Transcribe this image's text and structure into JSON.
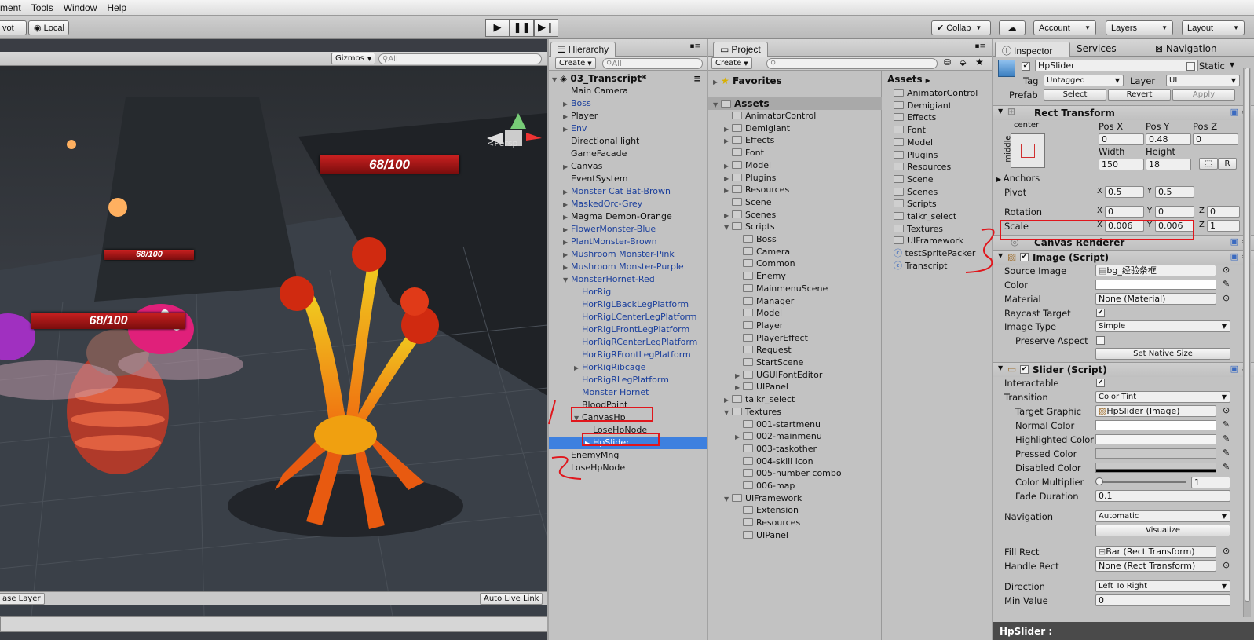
{
  "menubar": {
    "items": [
      "ment",
      "Tools",
      "Window",
      "Help"
    ]
  },
  "toolbar": {
    "pivot": "vot",
    "local": "Local",
    "collab": "Collab",
    "account": "Account",
    "layers": "Layers",
    "layout": "Layout"
  },
  "scene": {
    "gizmos": "Gizmos",
    "search": "All",
    "persp": "Persp",
    "hp_texts": [
      "68/100",
      "68/100",
      "68/100"
    ],
    "bottom_left": "ase Layer",
    "auto_live_link": "Auto Live Link"
  },
  "hierarchy": {
    "tab": "Hierarchy",
    "create": "Create",
    "search": "All",
    "scene_name": "03_Transcript*",
    "items": [
      {
        "label": "Main Camera",
        "indent": 1,
        "arrow": "",
        "style": "normal"
      },
      {
        "label": "Boss",
        "indent": 1,
        "arrow": "right",
        "style": "blue"
      },
      {
        "label": "Player",
        "indent": 1,
        "arrow": "right",
        "style": "normal"
      },
      {
        "label": "Env",
        "indent": 1,
        "arrow": "right",
        "style": "blue"
      },
      {
        "label": "Directional light",
        "indent": 1,
        "arrow": "",
        "style": "normal"
      },
      {
        "label": "GameFacade",
        "indent": 1,
        "arrow": "",
        "style": "normal"
      },
      {
        "label": "Canvas",
        "indent": 1,
        "arrow": "right",
        "style": "normal"
      },
      {
        "label": "EventSystem",
        "indent": 1,
        "arrow": "",
        "style": "normal"
      },
      {
        "label": "Monster Cat Bat-Brown",
        "indent": 1,
        "arrow": "right",
        "style": "blue"
      },
      {
        "label": "MaskedOrc-Grey",
        "indent": 1,
        "arrow": "right",
        "style": "blue"
      },
      {
        "label": "Magma Demon-Orange",
        "indent": 1,
        "arrow": "right",
        "style": "normal"
      },
      {
        "label": "FlowerMonster-Blue",
        "indent": 1,
        "arrow": "right",
        "style": "blue"
      },
      {
        "label": "PlantMonster-Brown",
        "indent": 1,
        "arrow": "right",
        "style": "blue"
      },
      {
        "label": "Mushroom Monster-Pink",
        "indent": 1,
        "arrow": "right",
        "style": "blue"
      },
      {
        "label": "Mushroom Monster-Purple",
        "indent": 1,
        "arrow": "right",
        "style": "blue"
      },
      {
        "label": "MonsterHornet-Red",
        "indent": 1,
        "arrow": "down",
        "style": "blue"
      },
      {
        "label": "HorRig",
        "indent": 2,
        "arrow": "",
        "style": "blue"
      },
      {
        "label": "HorRigLBackLegPlatform",
        "indent": 2,
        "arrow": "",
        "style": "blue"
      },
      {
        "label": "HorRigLCenterLegPlatform",
        "indent": 2,
        "arrow": "",
        "style": "blue"
      },
      {
        "label": "HorRigLFrontLegPlatform",
        "indent": 2,
        "arrow": "",
        "style": "blue"
      },
      {
        "label": "HorRigRCenterLegPlatform",
        "indent": 2,
        "arrow": "",
        "style": "blue"
      },
      {
        "label": "HorRigRFrontLegPlatform",
        "indent": 2,
        "arrow": "",
        "style": "blue"
      },
      {
        "label": "HorRigRibcage",
        "indent": 2,
        "arrow": "right",
        "style": "blue"
      },
      {
        "label": "HorRigRLegPlatform",
        "indent": 2,
        "arrow": "",
        "style": "blue"
      },
      {
        "label": "Monster Hornet",
        "indent": 2,
        "arrow": "",
        "style": "blue"
      },
      {
        "label": "BloodPoint",
        "indent": 2,
        "arrow": "",
        "style": "normal"
      },
      {
        "label": "CanvasHp",
        "indent": 2,
        "arrow": "down",
        "style": "normal"
      },
      {
        "label": "LoseHpNode",
        "indent": 3,
        "arrow": "",
        "style": "normal"
      },
      {
        "label": "HpSlider",
        "indent": 3,
        "arrow": "right",
        "style": "selected"
      },
      {
        "label": "EnemyMng",
        "indent": 1,
        "arrow": "",
        "style": "normal"
      },
      {
        "label": "LoseHpNode",
        "indent": 1,
        "arrow": "",
        "style": "normal"
      }
    ]
  },
  "project": {
    "tab": "Project",
    "create": "Create",
    "favorites": "Favorites",
    "assets_root": "Assets",
    "breadcrumb": "Assets",
    "tree": [
      {
        "label": "AnimatorControl",
        "indent": 1,
        "arrow": ""
      },
      {
        "label": "Demigiant",
        "indent": 1,
        "arrow": "right"
      },
      {
        "label": "Effects",
        "indent": 1,
        "arrow": "right"
      },
      {
        "label": "Font",
        "indent": 1,
        "arrow": ""
      },
      {
        "label": "Model",
        "indent": 1,
        "arrow": "right"
      },
      {
        "label": "Plugins",
        "indent": 1,
        "arrow": "right"
      },
      {
        "label": "Resources",
        "indent": 1,
        "arrow": "right"
      },
      {
        "label": "Scene",
        "indent": 1,
        "arrow": ""
      },
      {
        "label": "Scenes",
        "indent": 1,
        "arrow": "right"
      },
      {
        "label": "Scripts",
        "indent": 1,
        "arrow": "down"
      },
      {
        "label": "Boss",
        "indent": 2,
        "arrow": ""
      },
      {
        "label": "Camera",
        "indent": 2,
        "arrow": ""
      },
      {
        "label": "Common",
        "indent": 2,
        "arrow": ""
      },
      {
        "label": "Enemy",
        "indent": 2,
        "arrow": ""
      },
      {
        "label": "MainmenuScene",
        "indent": 2,
        "arrow": ""
      },
      {
        "label": "Manager",
        "indent": 2,
        "arrow": ""
      },
      {
        "label": "Model",
        "indent": 2,
        "arrow": ""
      },
      {
        "label": "Player",
        "indent": 2,
        "arrow": ""
      },
      {
        "label": "PlayerEffect",
        "indent": 2,
        "arrow": ""
      },
      {
        "label": "Request",
        "indent": 2,
        "arrow": ""
      },
      {
        "label": "StartScene",
        "indent": 2,
        "arrow": ""
      },
      {
        "label": "UGUIFontEditor",
        "indent": 2,
        "arrow": "right"
      },
      {
        "label": "UIPanel",
        "indent": 2,
        "arrow": "right"
      },
      {
        "label": "taikr_select",
        "indent": 1,
        "arrow": "right"
      },
      {
        "label": "Textures",
        "indent": 1,
        "arrow": "down"
      },
      {
        "label": "001-startmenu",
        "indent": 2,
        "arrow": ""
      },
      {
        "label": "002-mainmenu",
        "indent": 2,
        "arrow": "right"
      },
      {
        "label": "003-taskother",
        "indent": 2,
        "arrow": ""
      },
      {
        "label": "004-skill icon",
        "indent": 2,
        "arrow": ""
      },
      {
        "label": "005-number combo",
        "indent": 2,
        "arrow": ""
      },
      {
        "label": "006-map",
        "indent": 2,
        "arrow": ""
      },
      {
        "label": "UIFramework",
        "indent": 1,
        "arrow": "down"
      },
      {
        "label": "Extension",
        "indent": 2,
        "arrow": ""
      },
      {
        "label": "Resources",
        "indent": 2,
        "arrow": ""
      },
      {
        "label": "UIPanel",
        "indent": 2,
        "arrow": ""
      }
    ],
    "assets": [
      {
        "label": "AnimatorControl",
        "type": "folder"
      },
      {
        "label": "Demigiant",
        "type": "folder"
      },
      {
        "label": "Effects",
        "type": "folder"
      },
      {
        "label": "Font",
        "type": "folder"
      },
      {
        "label": "Model",
        "type": "folder"
      },
      {
        "label": "Plugins",
        "type": "folder"
      },
      {
        "label": "Resources",
        "type": "folder"
      },
      {
        "label": "Scene",
        "type": "folder"
      },
      {
        "label": "Scenes",
        "type": "folder"
      },
      {
        "label": "Scripts",
        "type": "folder"
      },
      {
        "label": "taikr_select",
        "type": "folder"
      },
      {
        "label": "Textures",
        "type": "folder"
      },
      {
        "label": "UIFramework",
        "type": "folder"
      },
      {
        "label": "testSpritePacker",
        "type": "script"
      },
      {
        "label": "Transcript",
        "type": "script"
      }
    ]
  },
  "inspector": {
    "tabs": [
      "Inspector",
      "Services",
      "Navigation"
    ],
    "object_name": "HpSlider",
    "static_label": "Static",
    "tag_label": "Tag",
    "tag_value": "Untagged",
    "layer_label": "Layer",
    "layer_value": "UI",
    "prefab_label": "Prefab",
    "prefab_buttons": [
      "Select",
      "Revert",
      "Apply"
    ],
    "rect": {
      "title": "Rect Transform",
      "anchor_h": "center",
      "anchor_v": "middle",
      "posx_label": "Pos X",
      "posy_label": "Pos Y",
      "posz_label": "Pos Z",
      "posx": "0",
      "posy": "0.48",
      "posz": "0",
      "width_label": "Width",
      "height_label": "Height",
      "width": "150",
      "height": "18",
      "r_button": "R",
      "anchors": "Anchors",
      "pivot": "Pivot",
      "pivot_x": "0.5",
      "pivot_y": "0.5",
      "rotation": "Rotation",
      "rot_x": "0",
      "rot_y": "0",
      "rot_z": "0",
      "scale": "Scale",
      "scale_x": "0.006",
      "scale_y": "0.006",
      "scale_z": "1",
      "x": "X",
      "y": "Y",
      "z": "Z"
    },
    "canvas_renderer": {
      "title": "Canvas Renderer"
    },
    "image": {
      "title": "Image (Script)",
      "source_image_label": "Source Image",
      "source_image": "bg_经验条框",
      "color_label": "Color",
      "material_label": "Material",
      "material": "None (Material)",
      "raycast_label": "Raycast Target",
      "image_type_label": "Image Type",
      "image_type": "Simple",
      "preserve_label": "Preserve Aspect",
      "native_size": "Set Native Size"
    },
    "slider": {
      "title": "Slider (Script)",
      "interactable_label": "Interactable",
      "transition_label": "Transition",
      "transition": "Color Tint",
      "target_graphic_label": "Target Graphic",
      "target_graphic": "HpSlider (Image)",
      "normal_label": "Normal Color",
      "highlighted_label": "Highlighted Color",
      "pressed_label": "Pressed Color",
      "disabled_label": "Disabled Color",
      "multiplier_label": "Color Multiplier",
      "multiplier": "1",
      "fade_label": "Fade Duration",
      "fade": "0.1",
      "navigation_label": "Navigation",
      "navigation": "Automatic",
      "visualize": "Visualize",
      "fill_rect_label": "Fill Rect",
      "fill_rect": "Bar (Rect Transform)",
      "handle_rect_label": "Handle Rect",
      "handle_rect": "None (Rect Transform)",
      "direction_label": "Direction",
      "direction": "Left To Right",
      "min_label": "Min Value",
      "min": "0"
    },
    "footer": "HpSlider :"
  },
  "colors": {
    "selection": "#3d80df",
    "annotation": "#e0161c",
    "prefab_text": "#1b3f9c"
  }
}
